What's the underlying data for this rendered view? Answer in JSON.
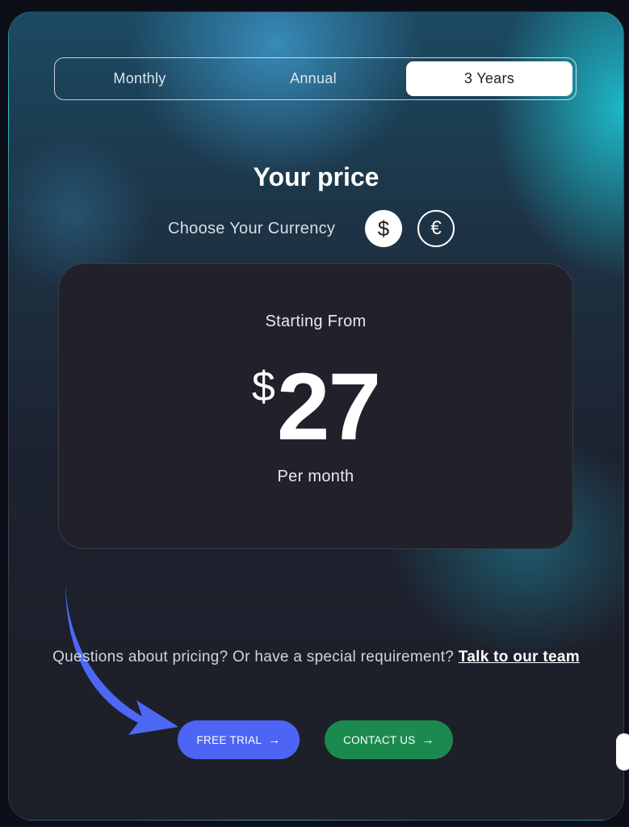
{
  "billing_toggle": {
    "options": [
      "Monthly",
      "Annual",
      "3 Years"
    ],
    "selected": "3 Years"
  },
  "header": {
    "title": "Your price",
    "currency_label": "Choose Your Currency",
    "currencies": [
      {
        "symbol": "$",
        "selected": true
      },
      {
        "symbol": "€",
        "selected": false
      }
    ]
  },
  "price_card": {
    "starting_label": "Starting From",
    "currency_symbol": "$",
    "amount": "27",
    "period_label": "Per month"
  },
  "footer": {
    "question_text": "Questions about pricing? Or have a special requirement?",
    "link_text": "Talk to our team",
    "trial_button": "FREE TRIAL",
    "contact_button": "CONTACT US"
  },
  "colors": {
    "trial_button": "#4e64f5",
    "contact_button": "#1b8a4f",
    "arrow": "#4e68f6"
  },
  "icons": {
    "button_arrow": "arrow-right-icon",
    "pointer": "curved-arrow-icon"
  }
}
